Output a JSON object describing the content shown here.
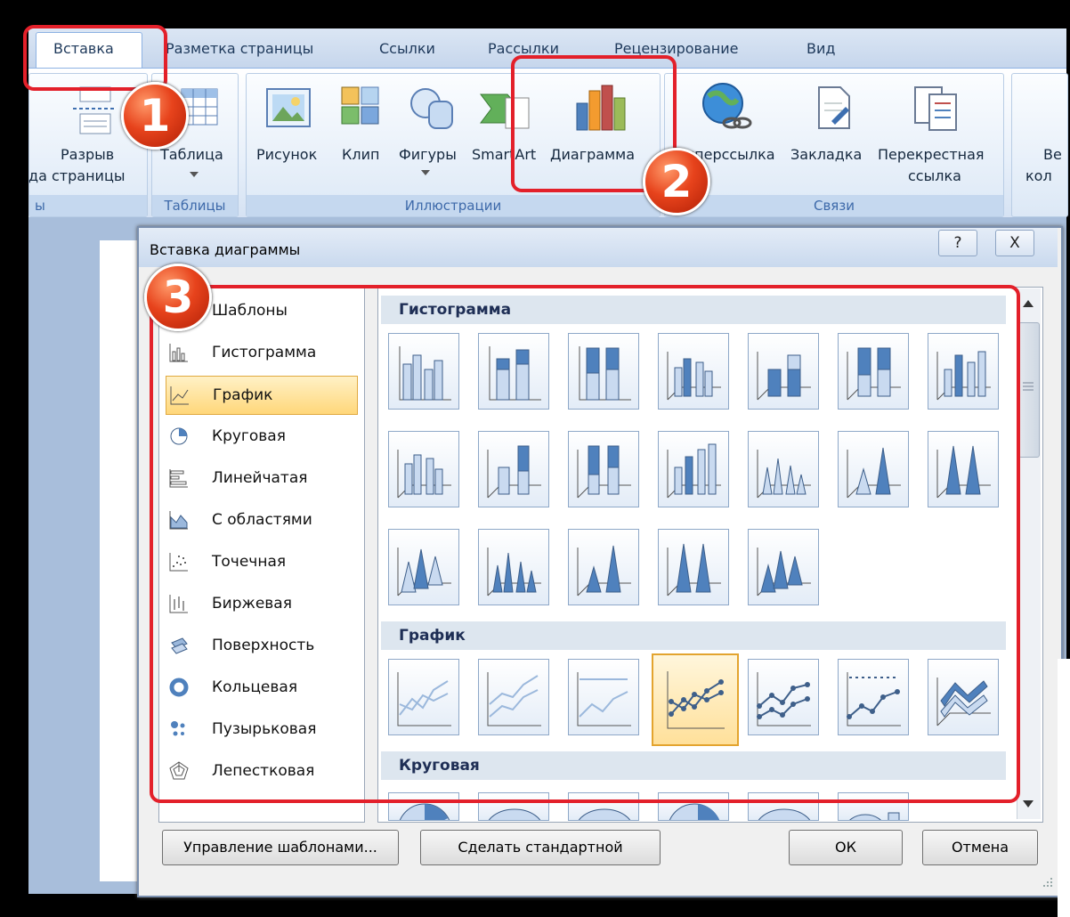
{
  "ribbon": {
    "tabs": [
      "Вставка",
      "Разметка страницы",
      "Ссылки",
      "Рассылки",
      "Рецензирование",
      "Вид"
    ],
    "buttons": {
      "page_break_top": "Разрыв",
      "page_break_bottom": "страницы",
      "page_break_prefix": "да",
      "table": "Таблица",
      "picture": "Рисунок",
      "clip": "Клип",
      "shapes": "Фигуры",
      "smartart": "SmartArt",
      "chart": "Диаграмма",
      "hyperlink": "Гиперссылка",
      "bookmark": "Закладка",
      "cross_ref_top": "Перекрестная",
      "cross_ref_bottom": "ссылка",
      "cut_top": "Ве",
      "cut_bottom": "кол"
    },
    "groups": {
      "pages_cut": "ы",
      "tables": "Таблицы",
      "illustrations": "Иллюстрации",
      "links": "Связи"
    }
  },
  "dialog": {
    "title": "Вставка диаграммы",
    "help": "?",
    "close": "X",
    "categories": [
      "Шаблоны",
      "Гистограмма",
      "График",
      "Круговая",
      "Линейчатая",
      "С областями",
      "Точечная",
      "Биржевая",
      "Поверхность",
      "Кольцевая",
      "Пузырьковая",
      "Лепестковая"
    ],
    "selected_category": "График",
    "sections": [
      "Гистограмма",
      "График",
      "Круговая"
    ],
    "buttons": {
      "manage_templates": "Управление шаблонами...",
      "set_default": "Сделать стандартной",
      "ok": "ОК",
      "cancel": "Отмена"
    }
  },
  "annotations": [
    "1",
    "2",
    "3"
  ],
  "colors": {
    "highlight": "#e3202a",
    "accent": "#e3a42f",
    "badge": "#e7431c"
  }
}
